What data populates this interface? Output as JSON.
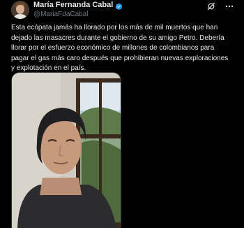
{
  "author": {
    "display_name": "María Fernanda Cabal",
    "handle": "@MariaFdaCabal",
    "verified": true,
    "verified_color": "#1d9bf0"
  },
  "icons": {
    "verified": "verified-badge-icon",
    "grok": "grok-icon",
    "more": "more-options-icon"
  },
  "tweet": {
    "text": "Esta ecópata jamás ha llorado por los más de mil muertos que han dejado las masacres durante el gobierno de su amigo Petro. Debería llorar por el esfuerzo económico de millones de colombianos para pagar el gas más caro después que prohibieran nuevas exploraciones y explotación en el país."
  },
  "media": {
    "type": "video-frame",
    "description_hidden": true
  },
  "colors": {
    "background": "#000000",
    "text": "#e7e9ea",
    "secondary": "#71767b"
  }
}
